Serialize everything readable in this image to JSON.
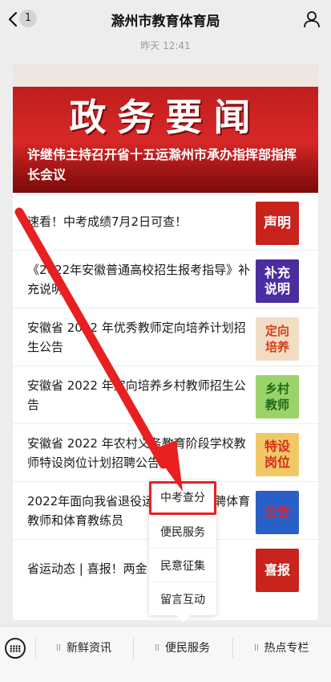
{
  "navbar": {
    "back_count": "1",
    "title": "滁州市教育体育局"
  },
  "message": {
    "timestamp": "昨天 12:41"
  },
  "banner": {
    "heading": "政务要闻",
    "caption": "许继伟主持召开省十五运滁州市承办指挥部指挥长会议"
  },
  "news": [
    {
      "text": "速看！中考成绩7月2日可查！",
      "thumb": "声明",
      "thumb_color": "#c8231d"
    },
    {
      "text": "《2022年安徽普通高校招生报考指导》补充说明",
      "thumb": "补充说明",
      "thumb_color": "#4a2d9e"
    },
    {
      "text": "安徽省 2022 年优秀教师定向培养计划招生公告",
      "thumb": "定向培养",
      "thumb_color": "#f1ddc4"
    },
    {
      "text": "安徽省 2022 年定向培养乡村教师招生公告",
      "thumb": "乡村教师",
      "thumb_color": "#9bd36a"
    },
    {
      "text": "安徽省 2022 年农村义务教育阶段学校教师特设岗位计划招聘公告",
      "thumb": "特设岗位",
      "thumb_color": "#f2c766"
    },
    {
      "text": "2022年面向我省退役运动员公开招聘体育教师和体育教练员",
      "thumb": "公告",
      "thumb_color": "#2a5fc7"
    },
    {
      "text": "省运动态 | 喜报！两金",
      "thumb": "喜报",
      "thumb_color": "#c8231d"
    }
  ],
  "popup_menu": {
    "items": [
      "中考查分",
      "便民服务",
      "民意征集",
      "留言互动"
    ],
    "highlighted": "中考查分"
  },
  "menubar": {
    "items": [
      "新鲜资讯",
      "便民服务",
      "热点专栏"
    ]
  },
  "colors": {
    "highlight": "#e8201f",
    "banner_red": "#c9201f"
  }
}
